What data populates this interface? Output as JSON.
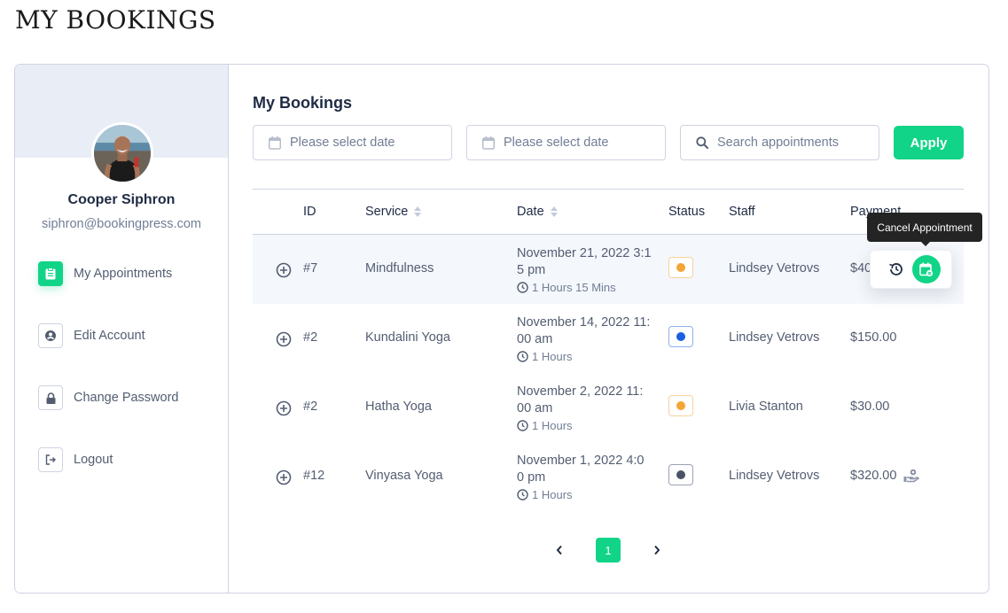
{
  "page": {
    "title": "MY BOOKINGS"
  },
  "profile": {
    "name": "Cooper Siphron",
    "email": "siphron@bookingpress.com",
    "avatar": "user-avatar-photo"
  },
  "sidebar": {
    "items": [
      {
        "label": "My Appointments",
        "icon": "clipboard-icon",
        "active": true
      },
      {
        "label": "Edit Account",
        "icon": "user-circle-icon",
        "active": false
      },
      {
        "label": "Change Password",
        "icon": "lock-icon",
        "active": false
      },
      {
        "label": "Logout",
        "icon": "logout-icon",
        "active": false
      }
    ]
  },
  "main": {
    "title": "My Bookings",
    "filters": {
      "start_date_placeholder": "Please select date",
      "end_date_placeholder": "Please select date",
      "search_placeholder": "Search appointments",
      "apply_label": "Apply"
    },
    "columns": [
      {
        "label": "ID",
        "sortable": false
      },
      {
        "label": "Service",
        "sortable": true
      },
      {
        "label": "Date",
        "sortable": true
      },
      {
        "label": "Status",
        "sortable": false
      },
      {
        "label": "Staff",
        "sortable": false
      },
      {
        "label": "Payment",
        "sortable": false
      }
    ],
    "rows": [
      {
        "id": "#7",
        "service": "Mindfulness",
        "date_line1": "November 21, 2022 3:1",
        "date_line2": "5 pm",
        "duration": "1 Hours 15 Mins",
        "status_color": "#f3a536",
        "status_border": "#f7d29c",
        "staff": "Lindsey Vetrovs",
        "payment": "$40.00",
        "hovered": true
      },
      {
        "id": "#2",
        "service": "Kundalini Yoga",
        "date_line1": "November 14, 2022 11:",
        "date_line2": "00 am",
        "duration": "1 Hours",
        "status_color": "#1a5fe0",
        "status_border": "#8fb0ee",
        "staff": "Lindsey Vetrovs",
        "payment": "$150.00"
      },
      {
        "id": "#2",
        "service": "Hatha Yoga",
        "date_line1": "November 2, 2022 11:",
        "date_line2": "00 am",
        "duration": "1 Hours",
        "status_color": "#f3a536",
        "status_border": "#f7d29c",
        "staff": "Livia Stanton",
        "payment": "$30.00"
      },
      {
        "id": "#12",
        "service": "Vinyasa Yoga",
        "date_line1": "November 1, 2022 4:0",
        "date_line2": "0 pm",
        "duration": "1 Hours",
        "status_color": "#4a5366",
        "status_border": "#9aa2b1",
        "staff": "Lindsey Vetrovs",
        "payment": "$320.00",
        "payment_icon": "hand-coin-icon"
      }
    ],
    "row_actions": {
      "tooltip": "Cancel Appointment",
      "history_icon": "history-icon",
      "cancel_icon": "calendar-cancel-icon"
    },
    "pagination": {
      "current_page": "1"
    }
  },
  "colors": {
    "accent": "#12d488",
    "text_primary": "#202c45",
    "text_secondary": "#535d71",
    "border": "#ced4e2",
    "sidebar_banner": "#e9edf5"
  }
}
